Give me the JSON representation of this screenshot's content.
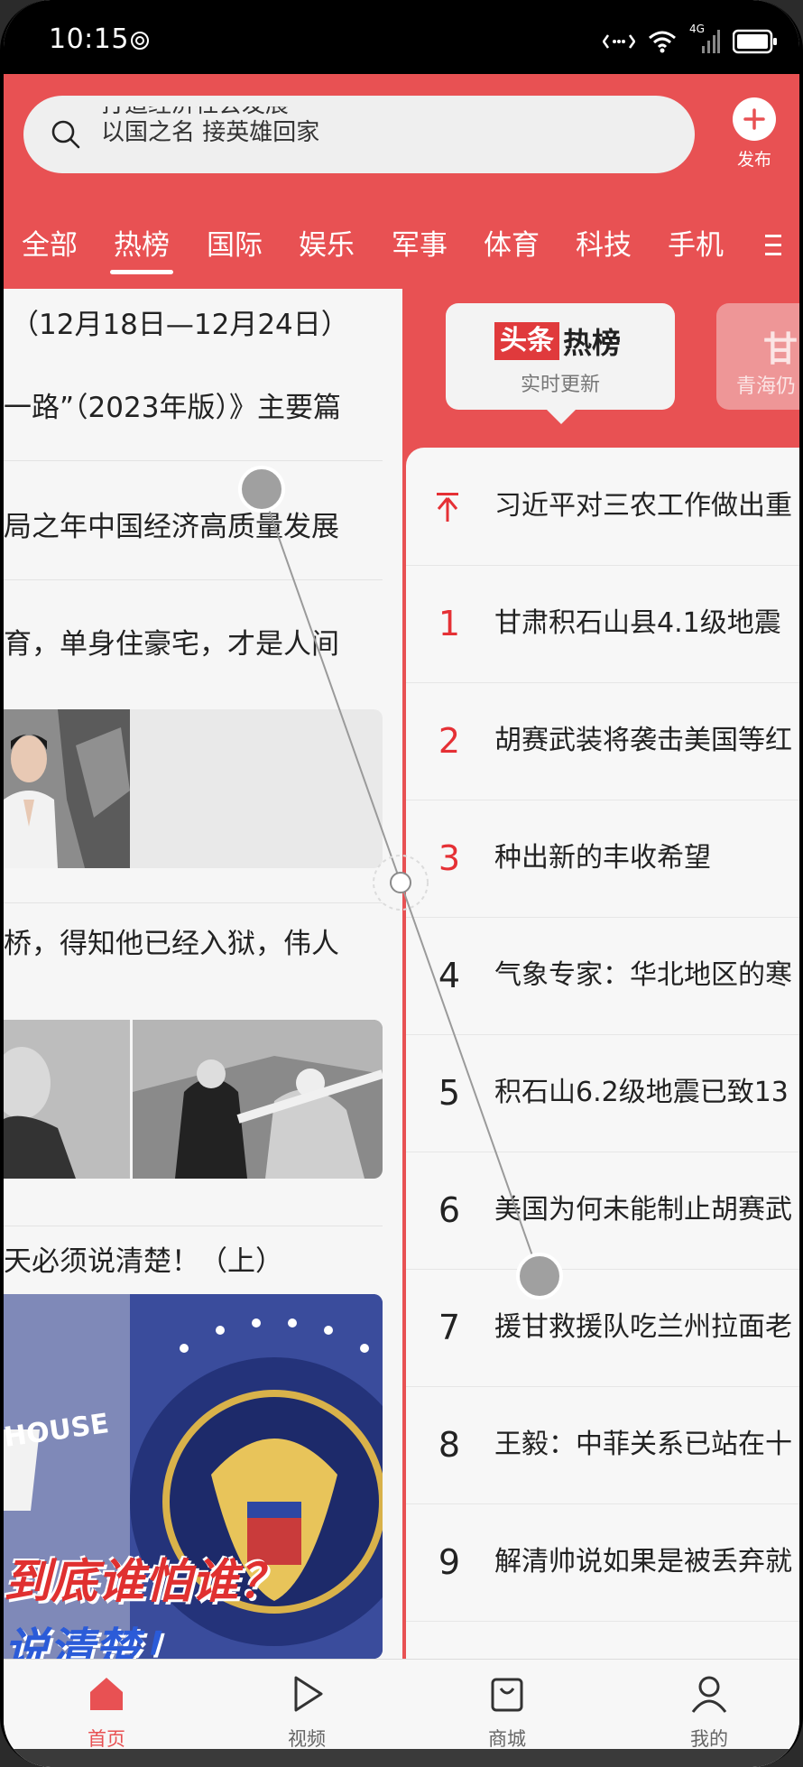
{
  "status_bar": {
    "time": "10:15",
    "network": "4G"
  },
  "search": {
    "line1": "打造经济社会发展",
    "line2": "以国之名 接英雄回家"
  },
  "publish": {
    "label": "发布"
  },
  "tabs": [
    "全部",
    "热榜",
    "国际",
    "娱乐",
    "军事",
    "体育",
    "科技",
    "手机"
  ],
  "active_tab": "热榜",
  "feed": {
    "line1": "（12月18日—12月24日）",
    "line2": "一路”（2023年版）》主要篇",
    "line3": "局之年中国经济高质量发展",
    "line4": "育，单身住豪宅，才是人间",
    "line5": "桥，得知他已经入狱，伟人",
    "line6": "天必须说清楚！（上）",
    "caption_a": "HOUSE",
    "caption_b": "到底谁怕谁？",
    "caption_c": "说清楚！"
  },
  "hot_card": {
    "badge": "头条",
    "title": "热榜",
    "subtitle": "实时更新"
  },
  "hot_card2": {
    "title": "甘",
    "subtitle": "青海仍"
  },
  "hot_list": [
    {
      "rank": "↑",
      "text": "习近平对三农工作做出重"
    },
    {
      "rank": "1",
      "text": "甘肃积石山县4.1级地震"
    },
    {
      "rank": "2",
      "text": "胡赛武装将袭击美国等红"
    },
    {
      "rank": "3",
      "text": "种出新的丰收希望"
    },
    {
      "rank": "4",
      "text": "气象专家：华北地区的寒"
    },
    {
      "rank": "5",
      "text": "积石山6.2级地震已致13"
    },
    {
      "rank": "6",
      "text": "美国为何未能制止胡赛武"
    },
    {
      "rank": "7",
      "text": "援甘救援队吃兰州拉面老"
    },
    {
      "rank": "8",
      "text": "王毅：中菲关系已站在十"
    },
    {
      "rank": "9",
      "text": "解清帅说如果是被丢弃就"
    }
  ],
  "bottom_nav": [
    {
      "label": "首页",
      "icon": "home-icon"
    },
    {
      "label": "视频",
      "icon": "play-icon"
    },
    {
      "label": "商城",
      "icon": "shopping-bag-icon"
    },
    {
      "label": "我的",
      "icon": "user-icon"
    }
  ],
  "colors": {
    "brand_red": "#e85153",
    "rank_red": "#e53035"
  }
}
